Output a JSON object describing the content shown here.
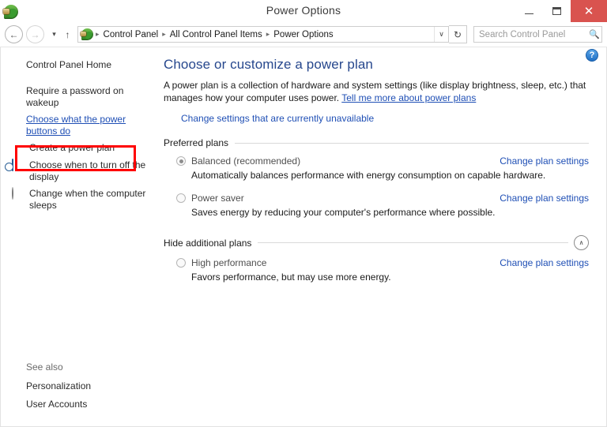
{
  "window": {
    "title": "Power Options",
    "icon": "power-plug-icon",
    "controls": {
      "minimize": "–",
      "maximize": "❐",
      "close": "✕",
      "close_color": "#d9534f"
    }
  },
  "navbar": {
    "back": "←",
    "forward": "→",
    "recent_dropdown": "▾",
    "up": "↑",
    "breadcrumb_icon": "power-plug-icon",
    "breadcrumbs": [
      "Control Panel",
      "All Control Panel Items",
      "Power Options"
    ],
    "separator": "▸",
    "address_dropdown": "∨",
    "refresh": "↻",
    "search": {
      "placeholder": "Search Control Panel",
      "value": "",
      "icon": "search-icon"
    }
  },
  "help": {
    "label": "?"
  },
  "sidebar": {
    "home": "Control Panel Home",
    "items": [
      {
        "label": "Require a password on wakeup",
        "icon": "",
        "style": "plain"
      },
      {
        "label": "Choose what the power buttons do",
        "icon": "",
        "style": "link-highlighted"
      },
      {
        "label": "Create a power plan",
        "icon": "shield-icon",
        "style": "plain"
      },
      {
        "label": "Choose when to turn off the display",
        "icon": "display-clock-icon",
        "style": "plain"
      },
      {
        "label": "Change when the computer sleeps",
        "icon": "moon-icon",
        "style": "plain"
      }
    ],
    "see_also": {
      "title": "See also",
      "links": [
        "Personalization",
        "User Accounts"
      ]
    },
    "highlight_color": "#ff0000"
  },
  "main": {
    "heading": "Choose or customize a power plan",
    "description_part1": "A power plan is a collection of hardware and system settings (like display brightness, sleep, etc.) that manages how your computer uses power. ",
    "description_link": "Tell me more about power plans",
    "uac_row": {
      "icon": "shield-icon",
      "label": "Change settings that are currently unavailable"
    },
    "preferred_section": {
      "title": "Preferred plans",
      "plans": [
        {
          "name": "Balanced (recommended)",
          "description": "Automatically balances performance with energy consumption on capable hardware.",
          "selected": true,
          "link": "Change plan settings"
        },
        {
          "name": "Power saver",
          "description": "Saves energy by reducing your computer's performance where possible.",
          "selected": false,
          "link": "Change plan settings"
        }
      ]
    },
    "additional_section": {
      "title": "Hide additional plans",
      "collapse_icon": "∧",
      "plans": [
        {
          "name": "High performance",
          "description": "Favors performance, but may use more energy.",
          "selected": false,
          "link": "Change plan settings"
        }
      ]
    }
  }
}
